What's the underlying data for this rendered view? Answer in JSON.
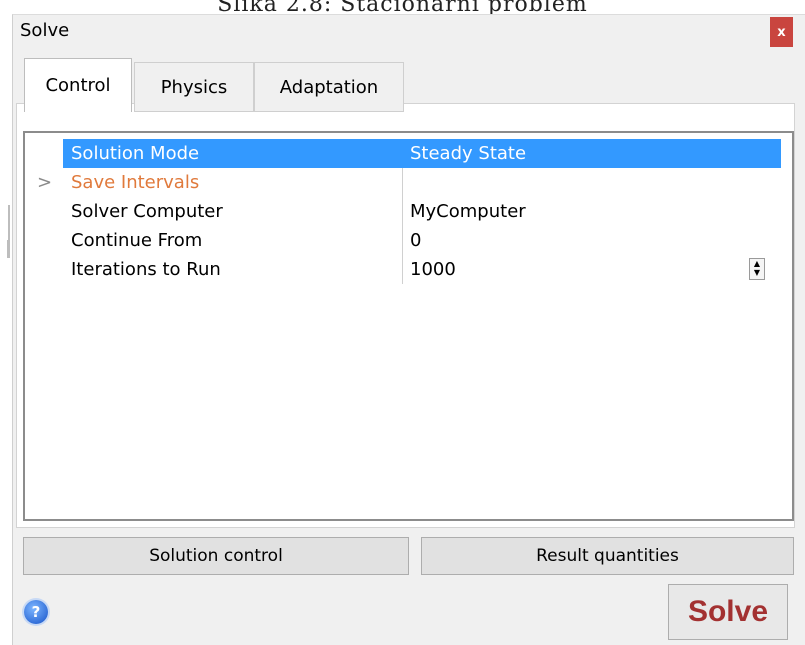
{
  "caption": "Slika 2.8: Stacionarni problem",
  "window": {
    "title": "Solve",
    "close_glyph": "x"
  },
  "tabs": [
    {
      "label": "Control",
      "active": true
    },
    {
      "label": "Physics",
      "active": false
    },
    {
      "label": "Adaptation",
      "active": false
    }
  ],
  "properties": [
    {
      "name": "Solution Mode",
      "value": "Steady State",
      "selected": true
    },
    {
      "name": "Save Intervals",
      "value": "",
      "category": true,
      "expander": ">"
    },
    {
      "name": "Solver Computer",
      "value": "MyComputer"
    },
    {
      "name": "Continue From",
      "value": "0"
    },
    {
      "name": "Iterations to Run",
      "value": "1000"
    }
  ],
  "buttons": {
    "solution_control": "Solution control",
    "result_quantities": "Result quantities",
    "solve": "Solve"
  },
  "help_icon_glyph": "?",
  "spinner": {
    "up": "▲",
    "down": "▼"
  },
  "colors": {
    "selection": "#3399ff",
    "category_text": "#e07a3c",
    "close_button": "#c9453f",
    "solve_text": "#a33131"
  }
}
